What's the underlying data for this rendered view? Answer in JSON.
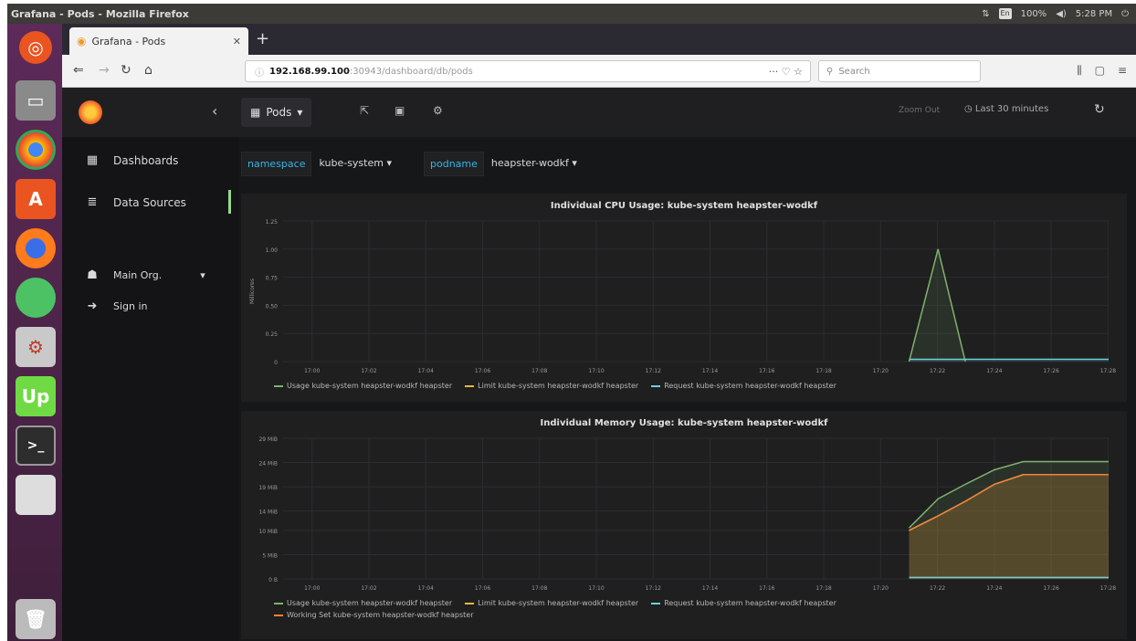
{
  "os": {
    "window_title": "Grafana - Pods - Mozilla Firefox",
    "clock": "5:28 PM",
    "tray_kbd": "En",
    "tray_battery": "100%"
  },
  "browser": {
    "tab_title": "Grafana - Pods",
    "url_host": "192.168.99.100",
    "url_path": ":30943/dashboard/db/pods",
    "url_right": "··· ♡ ☆",
    "search_placeholder": "Search"
  },
  "grafana": {
    "dashboard_title": "Pods",
    "zoom_out": "Zoom Out",
    "time_range": "Last 30 minutes",
    "sidebar": [
      {
        "label": "Dashboards"
      },
      {
        "label": "Data Sources"
      },
      {
        "label": "Main Org."
      },
      {
        "label": "Sign in"
      }
    ],
    "variables": [
      {
        "label": "namespace",
        "value": "kube-system ▾"
      },
      {
        "label": "podname",
        "value": "heapster-wodkf ▾"
      }
    ]
  },
  "chart_data": [
    {
      "type": "line",
      "title": "Individual CPU Usage: kube-system heapster-wodkf",
      "ylabel": "Millicores",
      "ylim": [
        0,
        1.25
      ],
      "yticks": [
        "1.25",
        "1.00",
        "0.75",
        "0.50",
        "0.25",
        "0"
      ],
      "xticks": [
        "17:00",
        "17:02",
        "17:04",
        "17:06",
        "17:08",
        "17:10",
        "17:12",
        "17:14",
        "17:16",
        "17:18",
        "17:20",
        "17:22",
        "17:24",
        "17:26",
        "17:28"
      ],
      "xrange": [
        16.983,
        17.467
      ],
      "series": [
        {
          "name": "Usage kube-system heapster-wodkf heapster",
          "color": "#7eb26d",
          "points": [
            [
              17.35,
              0
            ],
            [
              17.367,
              1.0
            ],
            [
              17.383,
              0
            ]
          ]
        },
        {
          "name": "Limit kube-system heapster-wodkf heapster",
          "color": "#eab839",
          "points": []
        },
        {
          "name": "Request kube-system heapster-wodkf heapster",
          "color": "#6ed0e0",
          "points": [
            [
              17.35,
              0.02
            ],
            [
              17.467,
              0.02
            ]
          ]
        }
      ]
    },
    {
      "type": "area",
      "title": "Individual Memory Usage: kube-system heapster-wodkf",
      "ylabel": "",
      "ylim": [
        0,
        29
      ],
      "yticks": [
        "29 MiB",
        "24 MiB",
        "19 MiB",
        "14 MiB",
        "10 MiB",
        "5 MiB",
        "0 B"
      ],
      "yvalues": [
        29,
        24,
        19,
        14,
        10,
        5,
        0
      ],
      "xticks": [
        "17:00",
        "17:02",
        "17:04",
        "17:06",
        "17:08",
        "17:10",
        "17:12",
        "17:14",
        "17:16",
        "17:18",
        "17:20",
        "17:22",
        "17:24",
        "17:26",
        "17:28"
      ],
      "xrange": [
        16.983,
        17.467
      ],
      "series": [
        {
          "name": "Usage kube-system heapster-wodkf heapster",
          "color": "#7eb26d",
          "points": [
            [
              17.35,
              10.5
            ],
            [
              17.367,
              16.5
            ],
            [
              17.383,
              19.5
            ],
            [
              17.4,
              22.5
            ],
            [
              17.417,
              24.2
            ],
            [
              17.467,
              24.2
            ]
          ]
        },
        {
          "name": "Limit kube-system heapster-wodkf heapster",
          "color": "#eab839",
          "points": [
            [
              17.35,
              10
            ],
            [
              17.367,
              13
            ],
            [
              17.383,
              16
            ],
            [
              17.4,
              19.5
            ],
            [
              17.417,
              21.5
            ],
            [
              17.467,
              21.5
            ]
          ]
        },
        {
          "name": "Request kube-system heapster-wodkf heapster",
          "color": "#6ed0e0",
          "points": [
            [
              17.35,
              0.3
            ],
            [
              17.467,
              0.3
            ]
          ]
        },
        {
          "name": "Working Set kube-system heapster-wodkf heapster",
          "color": "#ef843c",
          "points": [
            [
              17.35,
              10
            ],
            [
              17.367,
              13
            ],
            [
              17.383,
              16
            ],
            [
              17.4,
              19.5
            ],
            [
              17.417,
              21.5
            ],
            [
              17.467,
              21.5
            ]
          ]
        }
      ]
    }
  ]
}
